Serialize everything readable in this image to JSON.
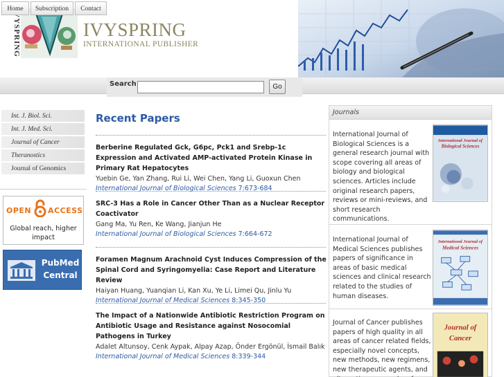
{
  "brand": {
    "vertical_logo_text": "IVYSPRING",
    "name": "IVYSPRING",
    "subtitle": "INTERNATIONAL PUBLISHER"
  },
  "nav": {
    "items": [
      {
        "label": "Home"
      },
      {
        "label": "Subscription"
      },
      {
        "label": "Contact"
      }
    ],
    "search_label": "Search",
    "search_value": "",
    "go_label": "Go"
  },
  "sidebar": {
    "items": [
      {
        "label": "Int. J. Biol. Sci."
      },
      {
        "label": "Int. J. Med. Sci."
      },
      {
        "label": "Journal of Cancer"
      },
      {
        "label": "Theranostics"
      },
      {
        "label": "Journal of Genomics"
      }
    ],
    "open_access": {
      "open": "OPEN",
      "access": "ACCESS",
      "tagline": "Global reach, higher impact"
    },
    "pubmed": {
      "line1": "PubMed",
      "line2": "Central"
    }
  },
  "main": {
    "title": "Recent Papers",
    "papers": [
      {
        "title": "Berberine Regulated Gck, G6pc, Pck1 and Srebp-1c Expression and Activated AMP-activated Protein Kinase in Primary Rat Hepatocytes",
        "authors": "Yuebin Ge, Yan Zhang, Rui Li, Wei Chen, Yang Li, Guoxun Chen",
        "journal": "International Journal of Biological Sciences",
        "citation": "7:673-684"
      },
      {
        "title": "SRC-3 Has a Role in Cancer Other Than as a Nuclear Receptor Coactivator",
        "authors": "Gang Ma, Yu Ren, Ke Wang, Jianjun He",
        "journal": "International Journal of Biological Sciences",
        "citation": "7:664-672"
      },
      {
        "title": "Foramen Magnum Arachnoid Cyst Induces Compression of the Spinal Cord and Syringomyelia: Case Report and Literature Review",
        "authors": "Haiyan Huang, Yuanqian Li, Kan Xu, Ye Li, Limei Qu, Jinlu Yu",
        "journal": "International Journal of Medical Sciences",
        "citation": "8:345-350"
      },
      {
        "title": "The Impact of a Nationwide Antibiotic Restriction Program on Antibiotic Usage and Resistance against Nosocomial Pathogens in Turkey",
        "authors": "Adalet Altunsoy, Cenk Aypak, Alpay Azap, Önder Ergönül, İsmail Balık",
        "journal": "International Journal of Medical Sciences",
        "citation": "8:339-344"
      }
    ]
  },
  "journals": {
    "heading": "Journals",
    "entries": [
      {
        "description": "International Journal of Biological Sciences is a general research journal with scope covering all areas of biology and biological sciences. Articles include original research papers, reviews or mini-reviews, and short research communications.",
        "cover_title": "International Journal of Biological Sciences",
        "cover_color": "#d9e4ef"
      },
      {
        "description": "International Journal of Medical Sciences publishes papers of significance in areas of basic medical sciences and clinical research related to the studies of human diseases.",
        "cover_title": "International Journal of Medical Sciences",
        "cover_color": "#e6eef5"
      },
      {
        "description": "Journal of Cancer publishes papers of high quality in all areas of cancer related fields, especially novel concepts, new methods, new regimens, new therapeutic agents, and alternative approaches for early",
        "cover_title": "Journal of Cancer",
        "cover_color": "#f3e9b8"
      }
    ]
  },
  "colors": {
    "accent_blue": "#2a5ba5",
    "brand_gold": "#8a8660",
    "oa_orange": "#e8731a",
    "pubmed_blue": "#3a6db0"
  }
}
